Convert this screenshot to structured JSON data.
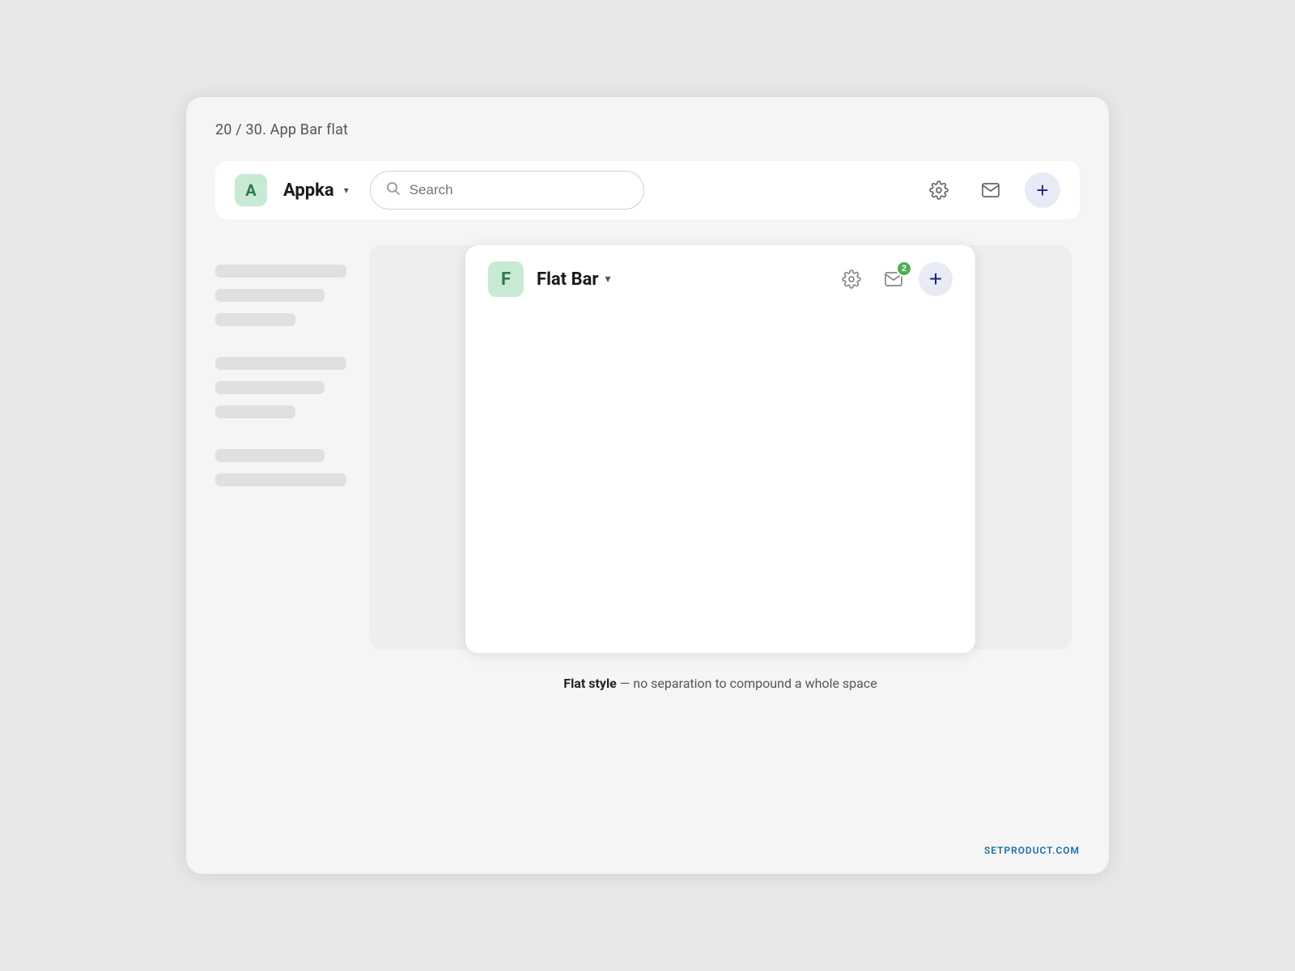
{
  "slide_label": "20 / 30. App Bar flat",
  "app_bar": {
    "avatar_letter": "A",
    "title": "Appka",
    "search_placeholder": "Search",
    "chevron": "▾"
  },
  "flat_bar": {
    "avatar_letter": "F",
    "title": "Flat Bar",
    "chevron": "▾",
    "badge_count": "2"
  },
  "description_bold": "Flat style",
  "description_rest": " — no separation to compound a whole space",
  "attribution": "SETPRODUCT.COM",
  "sidebar_skeleton": [
    "long",
    "medium",
    "short",
    "long",
    "medium",
    "short",
    "long",
    "medium"
  ]
}
